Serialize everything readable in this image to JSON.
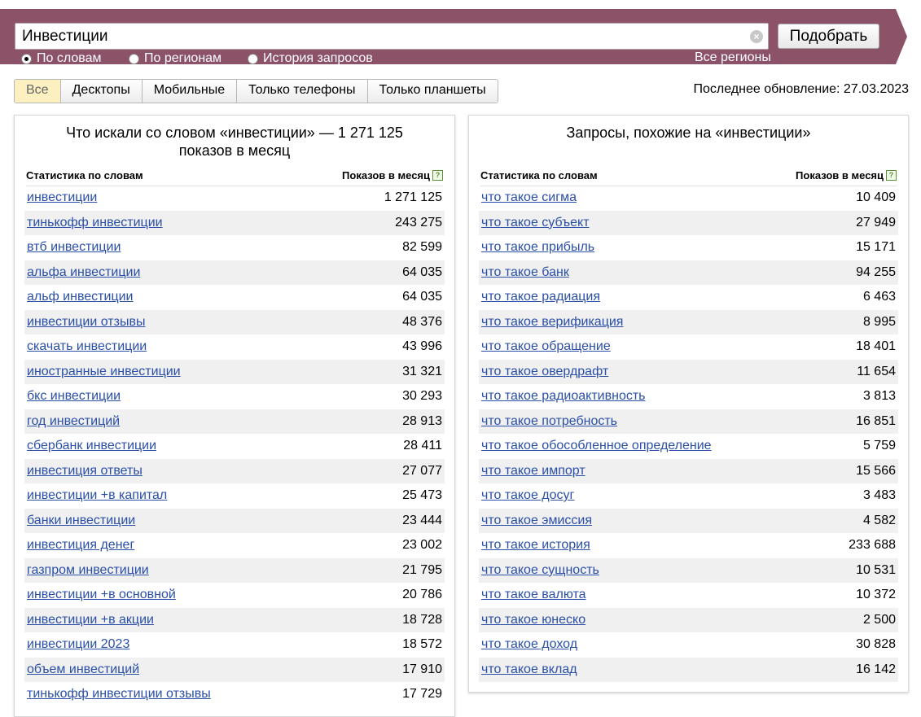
{
  "search": {
    "value": "Инвестиции",
    "submit_label": "Подобрать"
  },
  "modes": [
    {
      "label": "По словам",
      "checked": true
    },
    {
      "label": "По регионам",
      "checked": false
    },
    {
      "label": "История запросов",
      "checked": false
    }
  ],
  "all_regions_label": "Все регионы",
  "tabs": [
    {
      "label": "Все",
      "active": true
    },
    {
      "label": "Десктопы",
      "active": false
    },
    {
      "label": "Мобильные",
      "active": false
    },
    {
      "label": "Только телефоны",
      "active": false
    },
    {
      "label": "Только планшеты",
      "active": false
    }
  ],
  "last_update": "Последнее обновление: 27.03.2023",
  "left_panel": {
    "title": "Что искали со словом «инвестиции» — 1 271 125 показов в месяц",
    "col_word": "Статистика по словам",
    "col_count": "Показов в месяц",
    "rows": [
      {
        "word": "инвестиции",
        "count": "1 271 125"
      },
      {
        "word": "тинькофф инвестиции",
        "count": "243 275"
      },
      {
        "word": "втб инвестиции",
        "count": "82 599"
      },
      {
        "word": "альфа инвестиции",
        "count": "64 035"
      },
      {
        "word": "альф инвестиции",
        "count": "64 035"
      },
      {
        "word": "инвестиции отзывы",
        "count": "48 376"
      },
      {
        "word": "скачать инвестиции",
        "count": "43 996"
      },
      {
        "word": "иностранные инвестиции",
        "count": "31 321"
      },
      {
        "word": "бкс инвестиции",
        "count": "30 293"
      },
      {
        "word": "год инвестиций",
        "count": "28 913"
      },
      {
        "word": "сбербанк инвестиции",
        "count": "28 411"
      },
      {
        "word": "инвестиция ответы",
        "count": "27 077"
      },
      {
        "word": "инвестиции +в капитал",
        "count": "25 473"
      },
      {
        "word": "банки инвестиции",
        "count": "23 444"
      },
      {
        "word": "инвестиция денег",
        "count": "23 002"
      },
      {
        "word": "газпром инвестиции",
        "count": "21 795"
      },
      {
        "word": "инвестиции +в основной",
        "count": "20 786"
      },
      {
        "word": "инвестиции +в акции",
        "count": "18 728"
      },
      {
        "word": "инвестиции 2023",
        "count": "18 572"
      },
      {
        "word": "объем инвестиций",
        "count": "17 910"
      },
      {
        "word": "тинькофф инвестиции отзывы",
        "count": "17 729"
      }
    ]
  },
  "right_panel": {
    "title": "Запросы, похожие на «инвестиции»",
    "col_word": "Статистика по словам",
    "col_count": "Показов в месяц",
    "rows": [
      {
        "word": "что такое сигма",
        "count": "10 409"
      },
      {
        "word": "что такое субъект",
        "count": "27 949"
      },
      {
        "word": "что такое прибыль",
        "count": "15 171"
      },
      {
        "word": "что такое банк",
        "count": "94 255"
      },
      {
        "word": "что такое радиация",
        "count": "6 463"
      },
      {
        "word": "что такое верификация",
        "count": "8 995"
      },
      {
        "word": "что такое обращение",
        "count": "18 401"
      },
      {
        "word": "что такое овердрафт",
        "count": "11 654"
      },
      {
        "word": "что такое радиоактивность",
        "count": "3 813"
      },
      {
        "word": "что такое потребность",
        "count": "16 851"
      },
      {
        "word": "что такое обособленное определение",
        "count": "5 759"
      },
      {
        "word": "что такое импорт",
        "count": "15 566"
      },
      {
        "word": "что такое досуг",
        "count": "3 483"
      },
      {
        "word": "что такое эмиссия",
        "count": "4 582"
      },
      {
        "word": "что такое история",
        "count": "233 688"
      },
      {
        "word": "что такое сущность",
        "count": "10 531"
      },
      {
        "word": "что такое валюта",
        "count": "10 372"
      },
      {
        "word": "что такое юнеско",
        "count": "2 500"
      },
      {
        "word": "что такое доход",
        "count": "30 828"
      },
      {
        "word": "что такое вклад",
        "count": "16 142"
      }
    ]
  },
  "icons": {
    "clear": "clear-icon",
    "help": "help-icon"
  },
  "colors": {
    "header": "#8b5268",
    "link": "#2a4fa8",
    "active_tab": "#fcefc0"
  }
}
